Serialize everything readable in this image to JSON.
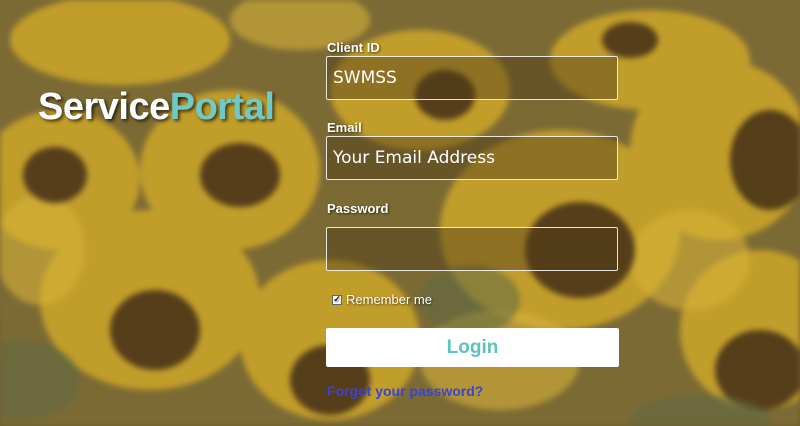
{
  "logo": {
    "part1": "Service",
    "part2": "Portal"
  },
  "form": {
    "client_id": {
      "label": "Client ID",
      "value": "SWMSS"
    },
    "email": {
      "label": "Email",
      "placeholder": "Your Email Address",
      "value": ""
    },
    "password": {
      "label": "Password",
      "value": ""
    },
    "remember": {
      "label": "Remember me",
      "checked": true
    },
    "login_label": "Login",
    "forgot_label": "Forgot your password?"
  },
  "colors": {
    "accent": "#6fc9c7",
    "link": "#3b42d6",
    "button_bg": "#ffffff"
  }
}
